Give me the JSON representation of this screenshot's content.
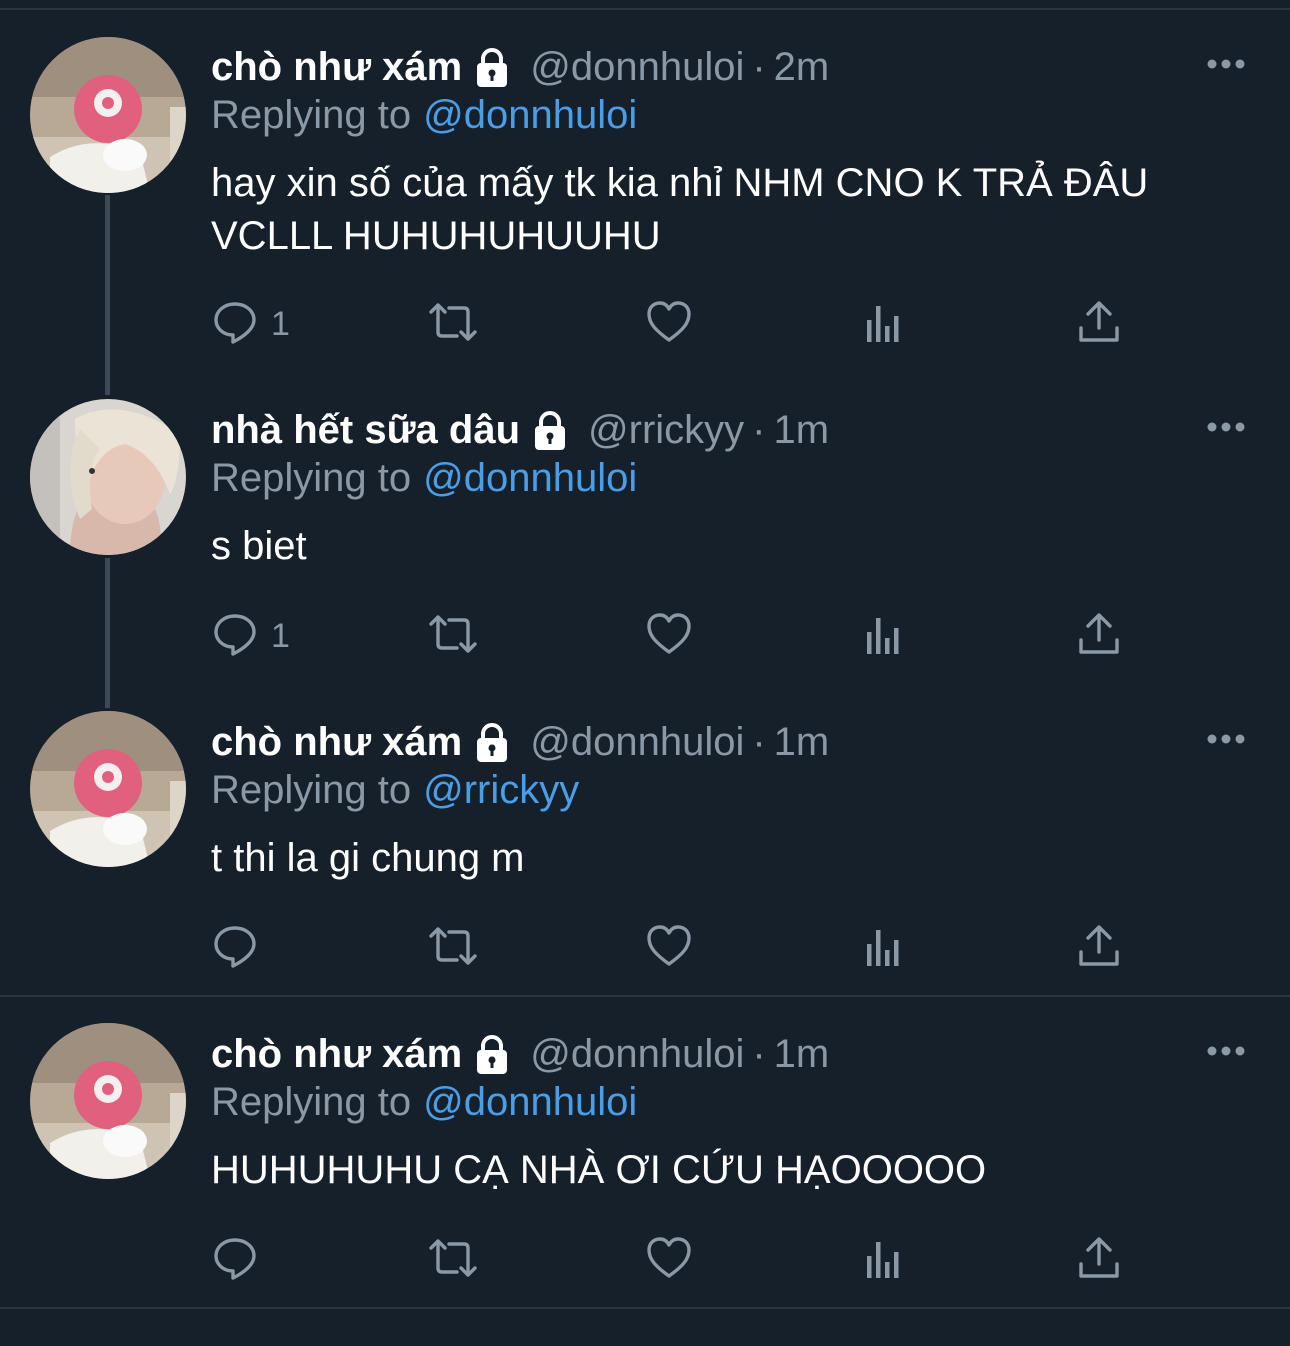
{
  "colors": {
    "background": "#15202b",
    "text": "#ffffff",
    "muted": "#8b98a5",
    "link": "#4a9ee8",
    "divider": "#2c3640"
  },
  "tweets": [
    {
      "name": "chò như xám",
      "handle": "@donnhuloi",
      "separator": "·",
      "time": "2m",
      "replying_label": "Replying to",
      "replying_to": "@donnhuloi",
      "text": "hay xin số của mấy tk kia nhỉ NHM CNO K TRẢ ĐÂU VCLLL HUHUHUHUUHU",
      "reply_count": "1",
      "avatar": "pink-flower-character-avatar"
    },
    {
      "name": "nhà hết sữa dâu",
      "handle": "@rrickyy",
      "separator": "·",
      "time": "1m",
      "replying_label": "Replying to",
      "replying_to": "@donnhuloi",
      "text": "s biet",
      "reply_count": "1",
      "avatar": "blond-person-photo-avatar"
    },
    {
      "name": "chò như xám",
      "handle": "@donnhuloi",
      "separator": "·",
      "time": "1m",
      "replying_label": "Replying to",
      "replying_to": "@rrickyy",
      "text": "t thi la gi chung m",
      "reply_count": "",
      "avatar": "pink-flower-character-avatar"
    },
    {
      "name": "chò như xám",
      "handle": "@donnhuloi",
      "separator": "·",
      "time": "1m",
      "replying_label": "Replying to",
      "replying_to": "@donnhuloi",
      "text": "HUHUHUHU CẠ NHÀ ƠI CỨU HẠOOOOO",
      "reply_count": "",
      "avatar": "pink-flower-character-avatar"
    }
  ],
  "icons": [
    "reply-icon",
    "retweet-icon",
    "like-icon",
    "analytics-icon",
    "share-icon",
    "more-icon",
    "lock-icon"
  ]
}
